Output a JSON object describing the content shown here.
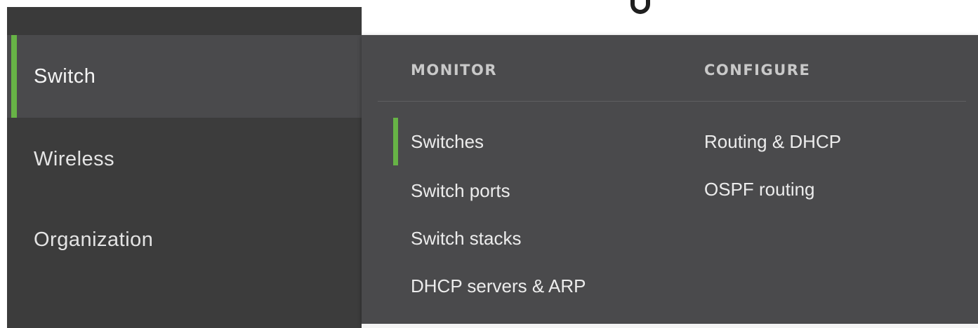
{
  "sidebar": {
    "items": [
      {
        "label": "Switch",
        "active": true
      },
      {
        "label": "Wireless",
        "active": false
      },
      {
        "label": "Organization",
        "active": false
      }
    ]
  },
  "flyout": {
    "monitor": {
      "heading": "MONITOR",
      "links": [
        "Switches",
        "Switch ports",
        "Switch stacks",
        "DHCP servers & ARP"
      ],
      "selected": "Switches"
    },
    "configure": {
      "heading": "CONFIGURE",
      "links": [
        "Routing & DHCP",
        "OSPF routing"
      ]
    }
  },
  "colors": {
    "accent": "#67b346",
    "sidebar_bg": "#3c3c3c",
    "flyout_bg": "#4a4a4c",
    "heading_text": "#c9c9c9",
    "link_text": "#ececec"
  }
}
